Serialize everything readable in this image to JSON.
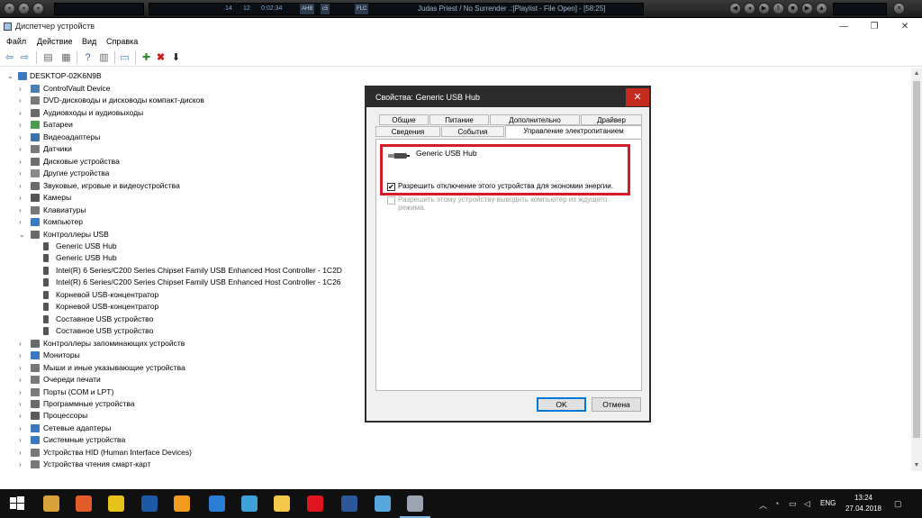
{
  "player": {
    "track_num": "14",
    "kbps": "12",
    "time": "0:02:34",
    "tags": [
      "AHB",
      "c5",
      "FLC"
    ],
    "title": "Judas Priest / No Surrender   .:[Playlist - File Open] - [58:25]",
    "icons": [
      "play-icon",
      "pause-icon",
      "stop-icon",
      "prev-icon",
      "next-icon"
    ]
  },
  "window": {
    "title": "Диспетчер устройств",
    "controls": [
      "—",
      "❐",
      "✕"
    ]
  },
  "menu": [
    "Файл",
    "Действие",
    "Вид",
    "Справка"
  ],
  "toolbar": {
    "icons": [
      "back-icon",
      "forward-icon",
      "properties-icon",
      "show-hidden-icon",
      "help-icon",
      "details-icon",
      "monitor-icon",
      "add-driver-icon",
      "remove-icon",
      "update-icon"
    ]
  },
  "tree": {
    "root": "DESKTOP-02K6N9B",
    "items": [
      {
        "label": "ControlVault Device",
        "level": 1,
        "expanded": false,
        "color": "#4a7fb5"
      },
      {
        "label": "DVD-дисководы и дисководы компакт-дисков",
        "level": 1,
        "expanded": false,
        "color": "#7a7a7a"
      },
      {
        "label": "Аудиовходы и аудиовыходы",
        "level": 1,
        "expanded": false,
        "color": "#6a6a6a"
      },
      {
        "label": "Батареи",
        "level": 1,
        "expanded": false,
        "color": "#4e9a4e"
      },
      {
        "label": "Видеоадаптеры",
        "level": 1,
        "expanded": false,
        "color": "#3d6fa8"
      },
      {
        "label": "Датчики",
        "level": 1,
        "expanded": false,
        "color": "#7a7a7a"
      },
      {
        "label": "Дисковые устройства",
        "level": 1,
        "expanded": false,
        "color": "#6e6e6e"
      },
      {
        "label": "Другие устройства",
        "level": 1,
        "expanded": false,
        "color": "#8a8a8a"
      },
      {
        "label": "Звуковые, игровые и видеоустройства",
        "level": 1,
        "expanded": false,
        "color": "#6a6a6a"
      },
      {
        "label": "Камеры",
        "level": 1,
        "expanded": false,
        "color": "#555555"
      },
      {
        "label": "Клавиатуры",
        "level": 1,
        "expanded": false,
        "color": "#777777"
      },
      {
        "label": "Компьютер",
        "level": 1,
        "expanded": false,
        "color": "#3b78c2"
      },
      {
        "label": "Контроллеры USB",
        "level": 1,
        "expanded": true,
        "color": "#6a6a6a"
      },
      {
        "label": "Generic USB Hub",
        "level": 2,
        "expanded": null,
        "color": "#555555"
      },
      {
        "label": "Generic USB Hub",
        "level": 2,
        "expanded": null,
        "color": "#555555"
      },
      {
        "label": "Intel(R) 6 Series/C200 Series Chipset Family USB Enhanced Host Controller - 1C2D",
        "level": 2,
        "expanded": null,
        "color": "#555555"
      },
      {
        "label": "Intel(R) 6 Series/C200 Series Chipset Family USB Enhanced Host Controller - 1C26",
        "level": 2,
        "expanded": null,
        "color": "#555555"
      },
      {
        "label": "Корневой USB-концентратор",
        "level": 2,
        "expanded": null,
        "color": "#555555"
      },
      {
        "label": "Корневой USB-концентратор",
        "level": 2,
        "expanded": null,
        "color": "#555555"
      },
      {
        "label": "Составное USB устройство",
        "level": 2,
        "expanded": null,
        "color": "#555555"
      },
      {
        "label": "Составное USB устройство",
        "level": 2,
        "expanded": null,
        "color": "#555555"
      },
      {
        "label": "Контроллеры запоминающих устройств",
        "level": 1,
        "expanded": false,
        "color": "#6a6a6a"
      },
      {
        "label": "Мониторы",
        "level": 1,
        "expanded": false,
        "color": "#3b78c2"
      },
      {
        "label": "Мыши и иные указывающие устройства",
        "level": 1,
        "expanded": false,
        "color": "#777777"
      },
      {
        "label": "Очереди печати",
        "level": 1,
        "expanded": false,
        "color": "#7a7a7a"
      },
      {
        "label": "Порты (COM и LPT)",
        "level": 1,
        "expanded": false,
        "color": "#7a7a7a"
      },
      {
        "label": "Программные устройства",
        "level": 1,
        "expanded": false,
        "color": "#6a6a6a"
      },
      {
        "label": "Процессоры",
        "level": 1,
        "expanded": false,
        "color": "#5a5a5a"
      },
      {
        "label": "Сетевые адаптеры",
        "level": 1,
        "expanded": false,
        "color": "#3b78c2"
      },
      {
        "label": "Системные устройства",
        "level": 1,
        "expanded": false,
        "color": "#3b78c2"
      },
      {
        "label": "Устройства HID (Human Interface Devices)",
        "level": 1,
        "expanded": false,
        "color": "#777777"
      },
      {
        "label": "Устройства чтения смарт-карт",
        "level": 1,
        "expanded": false,
        "color": "#777777"
      }
    ]
  },
  "dialog": {
    "title": "Свойства: Generic USB Hub",
    "close": "✕",
    "tabs_row1": [
      "Общие",
      "Питание",
      "Дополнительно",
      "Драйвер"
    ],
    "tabs_row2": [
      "Сведения",
      "События",
      "Управление электропитанием"
    ],
    "active_tab": "Управление электропитанием",
    "device_name": "Generic USB Hub",
    "option_allow_off": "Разрешить отключение этого устройства для экономии энергии.",
    "option_allow_off_checked": true,
    "option_wake": "Разрешить этому устройству выводить компьютер из ждущего режима.",
    "option_wake_checked": false,
    "ok": "OK",
    "cancel": "Отмена"
  },
  "taskbar": {
    "apps": [
      {
        "name": "start-icon",
        "color": "#ffffff"
      },
      {
        "name": "winamp-icon",
        "color": "#d9a13a"
      },
      {
        "name": "aimp-icon",
        "color": "#e25b2a"
      },
      {
        "name": "qbittorrent-icon",
        "color": "#e6c319"
      },
      {
        "name": "media-icon",
        "color": "#1c5aa6"
      },
      {
        "name": "fl-studio-icon",
        "color": "#f29b1e"
      },
      {
        "name": "ccleaner-icon",
        "color": "#2a7fd4"
      },
      {
        "name": "photo-icon",
        "color": "#3ea2d8"
      },
      {
        "name": "explorer-icon",
        "color": "#f4c84a"
      },
      {
        "name": "opera-icon",
        "color": "#e1151f"
      },
      {
        "name": "word-icon",
        "color": "#2b579a"
      },
      {
        "name": "network-app-icon",
        "color": "#56a7de"
      },
      {
        "name": "device-manager-icon",
        "color": "#9aa5b1"
      }
    ],
    "lang": "ENG",
    "time": "13:24",
    "date": "27.04.2018"
  }
}
